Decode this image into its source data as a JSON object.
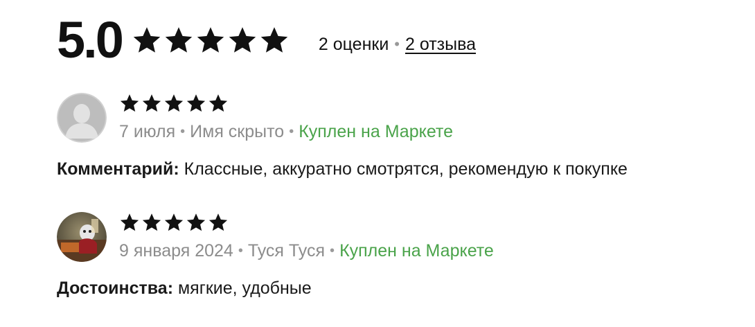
{
  "summary": {
    "rating": "5.0",
    "stars": 5,
    "ratings_count_text": "2 оценки",
    "separator": "•",
    "reviews_link_text": "2 отзыва"
  },
  "colors": {
    "star": "#111111",
    "bought": "#4aa34a",
    "meta": "#8c8c8c"
  },
  "reviews": [
    {
      "stars": 5,
      "date": "7 июля",
      "author": "Имя скрыто",
      "badge": "Куплен на Маркете",
      "text_label": "Комментарий:",
      "text_value": " Классные, аккуратно смотрятся, рекомендую к покупке",
      "avatar_icon": "default-user-avatar-icon"
    },
    {
      "stars": 5,
      "date": "9 января 2024",
      "author": "Туся Туся",
      "badge": "Куплен на Маркете",
      "text_label": "Достоинства:",
      "text_value": " мягкие, удобные",
      "avatar_icon": "user-photo-avatar"
    }
  ]
}
